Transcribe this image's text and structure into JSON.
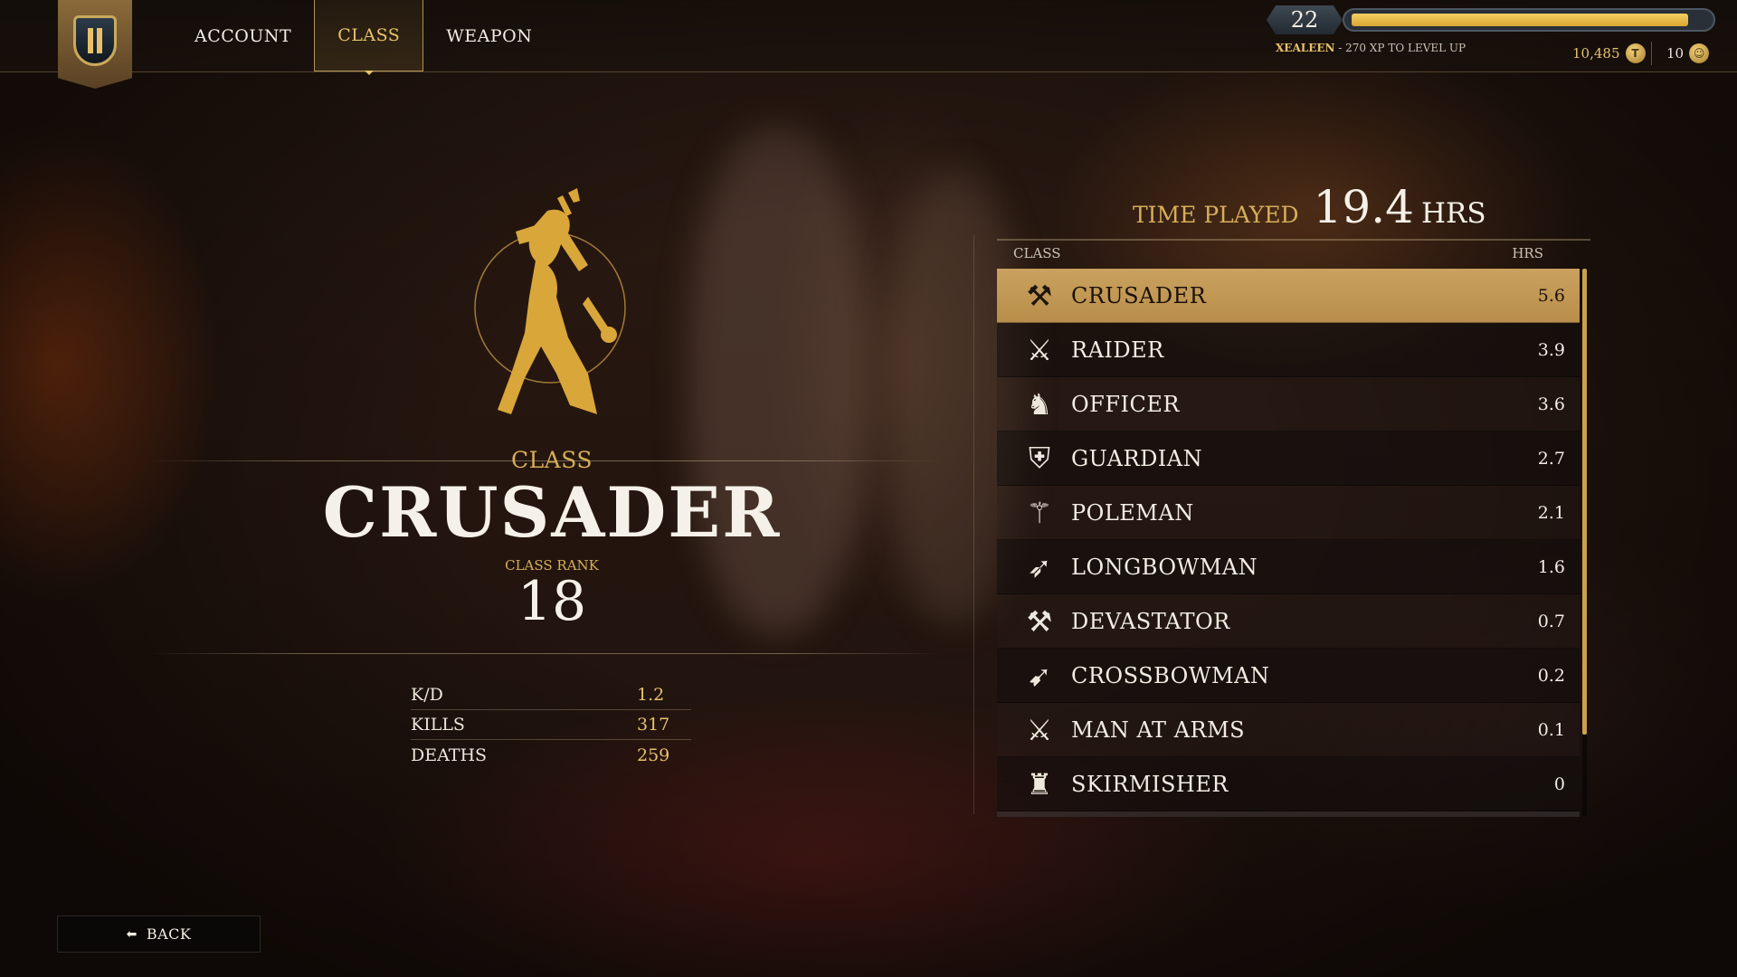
{
  "nav": {
    "tabs": [
      {
        "label": "ACCOUNT",
        "active": false
      },
      {
        "label": "CLASS",
        "active": true
      },
      {
        "label": "WEAPON",
        "active": false
      }
    ]
  },
  "player": {
    "level": "22",
    "xp_progress": 0.95,
    "name": "XEALEEN",
    "xp_text": "- 270 XP TO LEVEL UP",
    "gold": "10,485",
    "gold_icon": "T",
    "crowns": "10"
  },
  "class_panel": {
    "label": "CLASS",
    "name": "CRUSADER",
    "rank_label": "CLASS RANK",
    "rank": "18",
    "stats": [
      {
        "label": "K/D",
        "value": "1.2"
      },
      {
        "label": "KILLS",
        "value": "317"
      },
      {
        "label": "DEATHS",
        "value": "259"
      }
    ]
  },
  "time_played": {
    "label": "TIME PLAYED",
    "value": "19.4",
    "unit": "HRS"
  },
  "table": {
    "col_class": "CLASS",
    "col_hrs": "HRS",
    "rows": [
      {
        "name": "CRUSADER",
        "hrs": "5.6",
        "icon": "crusader-icon",
        "glyph": "⚒",
        "selected": true
      },
      {
        "name": "RAIDER",
        "hrs": "3.9",
        "icon": "raider-icon",
        "glyph": "⚔",
        "selected": false
      },
      {
        "name": "OFFICER",
        "hrs": "3.6",
        "icon": "officer-icon",
        "glyph": "♞",
        "selected": false
      },
      {
        "name": "GUARDIAN",
        "hrs": "2.7",
        "icon": "guardian-icon",
        "glyph": "⛨",
        "selected": false
      },
      {
        "name": "POLEMAN",
        "hrs": "2.1",
        "icon": "poleman-icon",
        "glyph": "⚚",
        "selected": false
      },
      {
        "name": "LONGBOWMAN",
        "hrs": "1.6",
        "icon": "longbowman-icon",
        "glyph": "➶",
        "selected": false
      },
      {
        "name": "DEVASTATOR",
        "hrs": "0.7",
        "icon": "devastator-icon",
        "glyph": "⚒",
        "selected": false
      },
      {
        "name": "CROSSBOWMAN",
        "hrs": "0.2",
        "icon": "crossbowman-icon",
        "glyph": "➹",
        "selected": false
      },
      {
        "name": "MAN AT ARMS",
        "hrs": "0.1",
        "icon": "man-at-arms-icon",
        "glyph": "⚔",
        "selected": false
      },
      {
        "name": "SKIRMISHER",
        "hrs": "0",
        "icon": "skirmisher-icon",
        "glyph": "♜",
        "selected": false
      }
    ]
  },
  "back": {
    "label": "BACK"
  },
  "colors": {
    "accent": "#e6c36b",
    "selected_row": "#caa15e",
    "xp_bar": "#f4cf62"
  }
}
